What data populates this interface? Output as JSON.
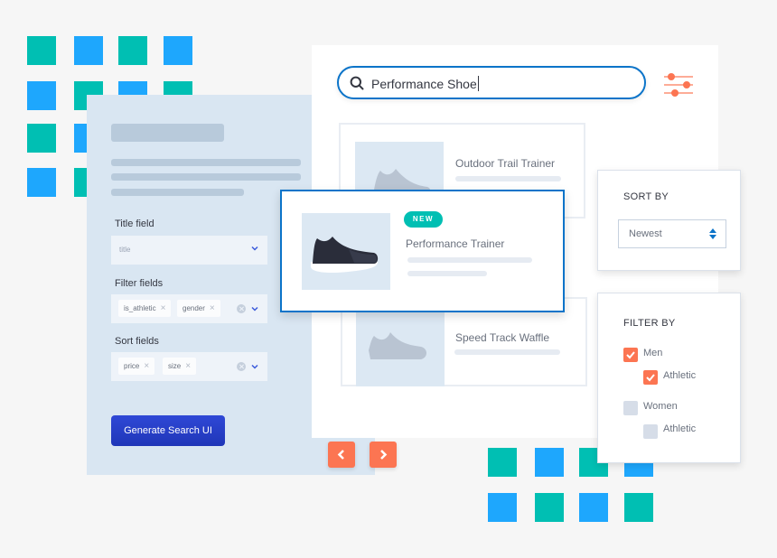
{
  "config_panel": {
    "title_field": {
      "label": "Title field",
      "placeholder": "title"
    },
    "filter_fields": {
      "label": "Filter fields",
      "chips": [
        "is_athletic",
        "gender"
      ]
    },
    "sort_fields": {
      "label": "Sort fields",
      "chips": [
        "price",
        "size"
      ]
    },
    "generate_button": "Generate Search UI"
  },
  "search": {
    "query": "Performance Shoe",
    "icon": "search-icon",
    "filter_toggle_icon": "sliders-icon"
  },
  "results": [
    {
      "title": "Outdoor Trail Trainer"
    },
    {
      "title": "Performance Trainer",
      "badge": "NEW",
      "featured": true
    },
    {
      "title": "Speed Track Waffle"
    }
  ],
  "pagination": {
    "prev_icon": "chevron-left-icon",
    "next_icon": "chevron-right-icon"
  },
  "sort": {
    "title": "SORT BY",
    "selected": "Newest"
  },
  "filter": {
    "title": "FILTER BY",
    "options": [
      {
        "label": "Men",
        "checked": true,
        "level": 0
      },
      {
        "label": "Athletic",
        "checked": true,
        "level": 1
      },
      {
        "label": "Women",
        "checked": false,
        "level": 0
      },
      {
        "label": "Athletic",
        "checked": false,
        "level": 1
      }
    ]
  },
  "colors": {
    "accent_blue": "#0b74c9",
    "accent_orange": "#fc7552",
    "teal": "#00bfb3",
    "sky_blue": "#1ea7fd",
    "button_blue": "#2f48d6"
  }
}
